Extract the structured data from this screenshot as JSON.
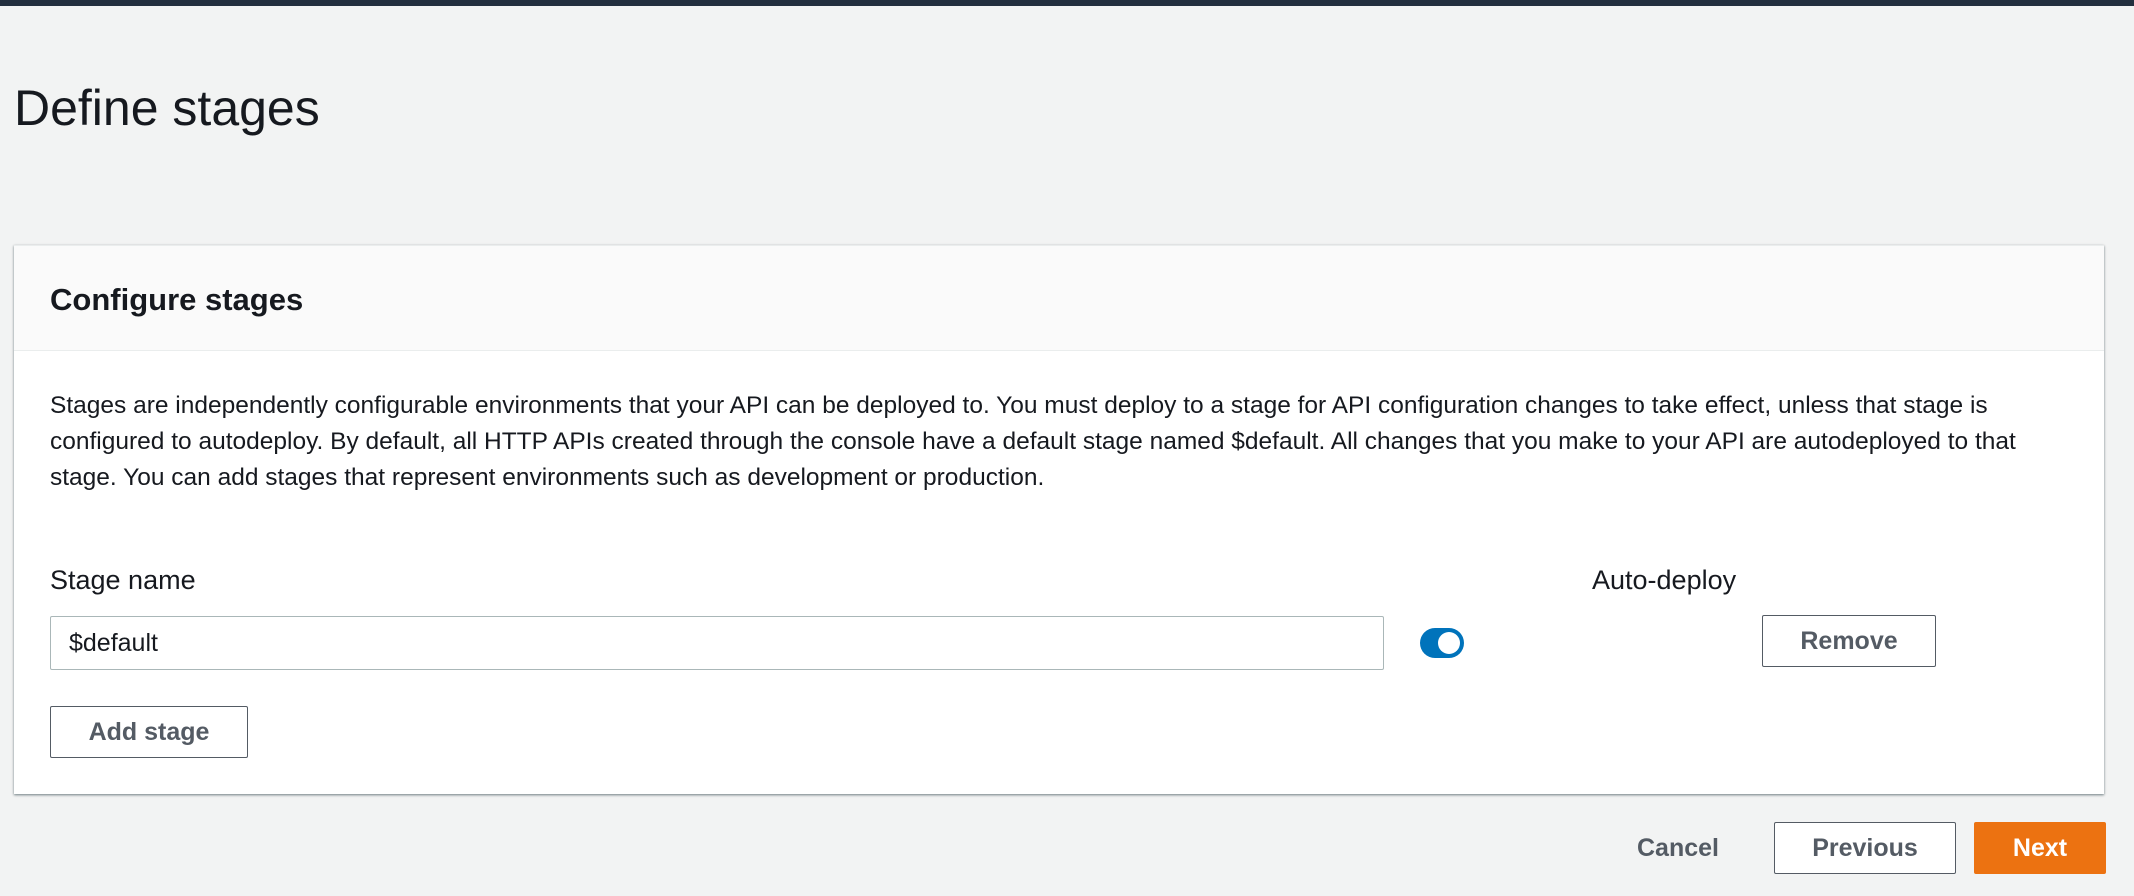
{
  "page": {
    "title": "Define stages"
  },
  "panel": {
    "title": "Configure stages",
    "description": "Stages are independently configurable environments that your API can be deployed to. You must deploy to a stage for API configuration changes to take effect, unless that stage is configured to autodeploy. By default, all HTTP APIs created through the console have a default stage named $default. All changes that you make to your API are autodeployed to that stage. You can add stages that represent environments such as development or production."
  },
  "form": {
    "stage_name_label": "Stage name",
    "auto_deploy_label": "Auto-deploy",
    "stages": [
      {
        "name": "$default",
        "auto_deploy": true,
        "remove_label": "Remove"
      }
    ],
    "add_stage_label": "Add stage"
  },
  "footer": {
    "cancel_label": "Cancel",
    "previous_label": "Previous",
    "next_label": "Next"
  },
  "colors": {
    "primary_orange": "#ec7211",
    "toggle_blue": "#0073bb",
    "top_bar": "#232f3e"
  }
}
